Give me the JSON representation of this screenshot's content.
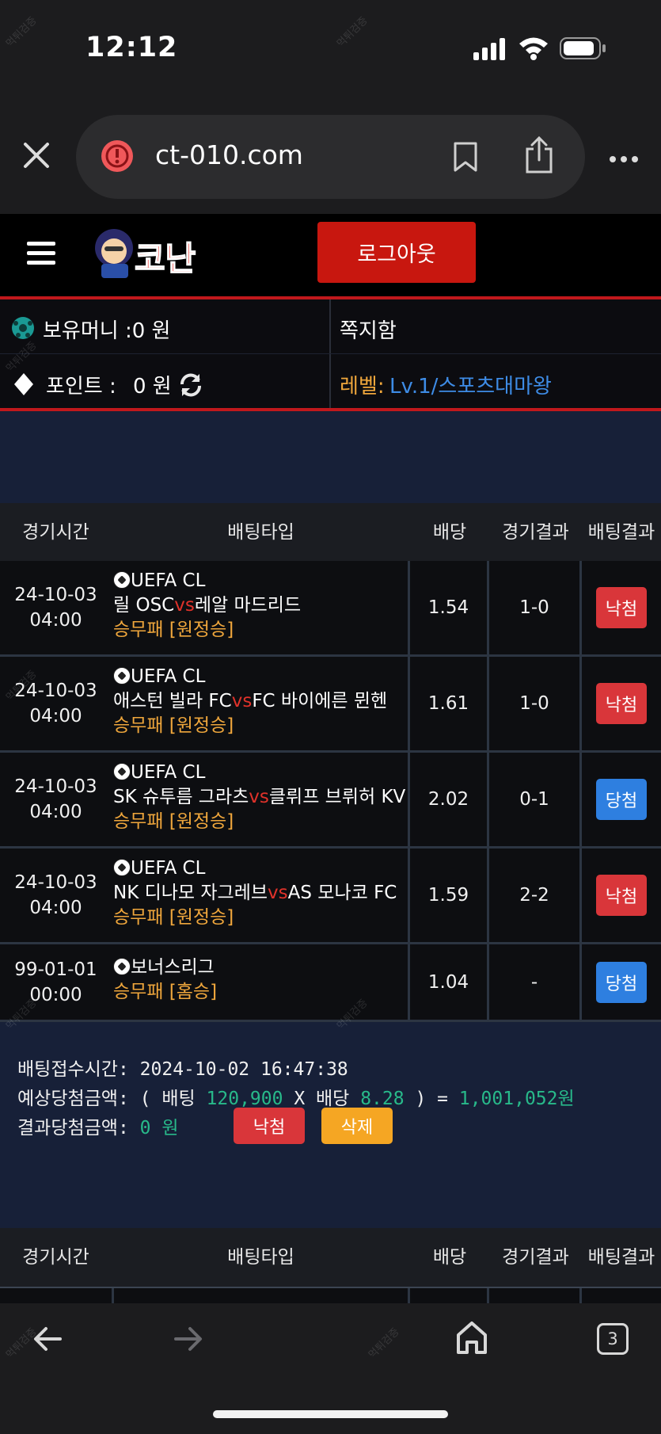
{
  "status_bar": {
    "time": "12:12",
    "battery": "85%"
  },
  "browser": {
    "url": "ct-010.com",
    "tabs_count": "3"
  },
  "site": {
    "logo_text": "코난",
    "logout_label": "로그아웃",
    "money_label": "보유머니 :0 원",
    "note_label": "쪽지함",
    "points_label": "포인트 :",
    "points_value": "0 원",
    "level_label": "레벨:",
    "level_value": "Lv.1/스포츠대마왕"
  },
  "table_headers": [
    "경기시간",
    "배팅타입",
    "배당",
    "경기결과",
    "배팅결과"
  ],
  "bets": [
    {
      "date": "24-10-03",
      "time": "04:00",
      "league": "UEFA CL",
      "home": "릴 OSC",
      "vs": "vs",
      "away": "레알 마드리드",
      "pick": "승무패 [원정승]",
      "odds": "1.54",
      "score": "1-0",
      "result": "낙첨",
      "result_color": "#d9363a"
    },
    {
      "date": "24-10-03",
      "time": "04:00",
      "league": "UEFA CL",
      "home": "애스턴 빌라 FC",
      "vs": "vs",
      "away": "FC 바이에른 뮌헨",
      "pick": "승무패 [원정승]",
      "odds": "1.61",
      "score": "1-0",
      "result": "낙첨",
      "result_color": "#d9363a"
    },
    {
      "date": "24-10-03",
      "time": "04:00",
      "league": "UEFA CL",
      "home": "SK 슈투름 그라츠",
      "vs": "vs",
      "away": "클뤼프 브뤼허 KV",
      "pick": "승무패 [원정승]",
      "odds": "2.02",
      "score": "0-1",
      "result": "당첨",
      "result_color": "#2e7fe0"
    },
    {
      "date": "24-10-03",
      "time": "04:00",
      "league": "UEFA CL",
      "home": "NK 디나모 자그레브",
      "vs": "vs",
      "away": "AS 모나코 FC",
      "pick": "승무패 [원정승]",
      "odds": "1.59",
      "score": "2-2",
      "result": "낙첨",
      "result_color": "#d9363a"
    },
    {
      "date": "99-01-01",
      "time": "00:00",
      "league": "보너스리그",
      "home": "",
      "vs": "",
      "away": "",
      "pick": "승무패 [홈승]",
      "odds": "1.04",
      "score": "-",
      "result": "당첨",
      "result_color": "#2e7fe0"
    }
  ],
  "summary": {
    "accepted_label": "배팅접수시간:",
    "accepted_value": "2024-10-02 16:47:38",
    "expected_label": "예상당첨금액: ( 배팅",
    "stake": "120,900",
    "x_label": "X 배당",
    "total_odds": "8.28",
    "eq_label": ") =",
    "expected_win": "1,001,052원",
    "result_label": "결과당첨금액:",
    "result_value": "0 원",
    "lose_button": "낙첨",
    "delete_button": "삭제"
  },
  "watermark": "먹튀검증"
}
